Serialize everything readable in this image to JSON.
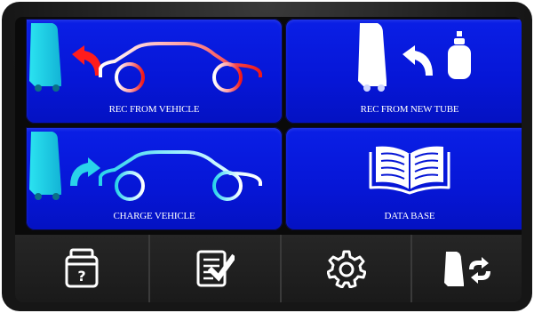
{
  "tiles": {
    "rec_from_vehicle": "REC FROM VEHICLE",
    "rec_from_new_tube": "REC FROM NEW TUBE",
    "charge_vehicle": "CHARGE VEHICLE",
    "data_base": "DATA BASE"
  },
  "icons": {
    "machine": "recovery-machine-icon",
    "car": "car-outline-icon",
    "arrow_back": "curved-arrow-left-icon",
    "arrow_forward": "curved-arrow-right-icon",
    "tank": "refrigerant-tank-icon",
    "book": "open-book-icon",
    "tank_question": "tank-question-icon",
    "checklist": "checklist-icon",
    "gear": "gear-icon",
    "machine_sync": "machine-sync-icon"
  },
  "colors": {
    "tile_blue": "#0616d6",
    "recover_red": "#e8201c",
    "charge_cyan": "#29d3ea",
    "bar_bg": "#1f1f1f",
    "icon_white": "#ffffff"
  }
}
